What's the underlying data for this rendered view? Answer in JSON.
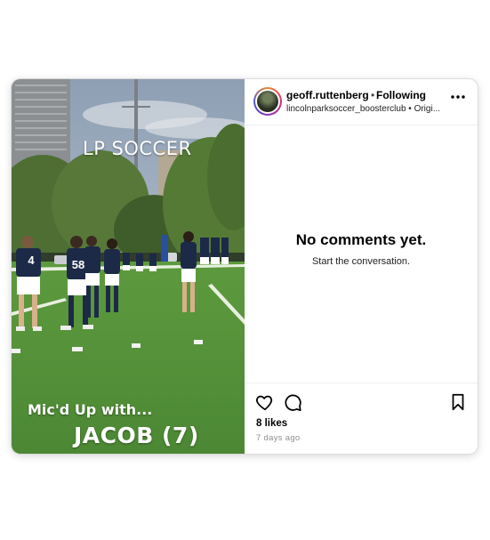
{
  "post": {
    "overlay": {
      "brand": "LP SOCCER",
      "line1": "Mic'd Up with...",
      "line2": "JACOB (7)"
    },
    "player_numbers": [
      "4",
      "58"
    ]
  },
  "header": {
    "username": "geoff.ruttenberg",
    "separator": "•",
    "follow_status": "Following",
    "subline": "lincolnparksoccer_boosterclub • Origi...",
    "more_label": "..."
  },
  "comments": {
    "empty_title": "No comments yet.",
    "empty_subtitle": "Start the conversation."
  },
  "footer": {
    "likes": "8 likes",
    "timestamp": "7 days ago"
  },
  "icons": {
    "like": "heart-icon",
    "comment": "comment-icon",
    "save": "bookmark-icon",
    "more": "more-options-icon"
  },
  "colors": {
    "follow": "#000000",
    "muted": "#8e8e8e",
    "divider": "#efefef"
  }
}
